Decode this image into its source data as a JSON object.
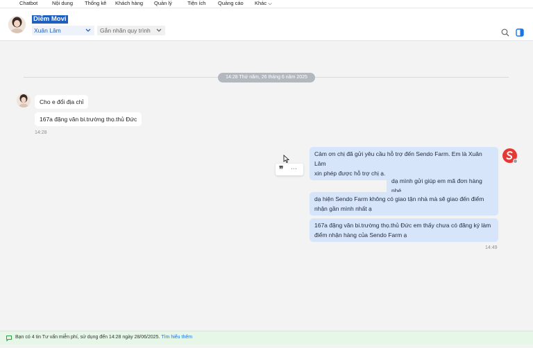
{
  "nav": {
    "items": [
      {
        "label": "Chatbot"
      },
      {
        "label": "Nội dung"
      },
      {
        "label": "Thống kê"
      },
      {
        "label": "Khách hàng"
      },
      {
        "label": "Quản lý"
      },
      {
        "label": "Tiện ích"
      },
      {
        "label": "Quảng cáo"
      },
      {
        "label": "Khác"
      }
    ]
  },
  "header": {
    "customer_name": "Diễm Movi",
    "assignee": "Xuân Lâm",
    "label_placeholder": "Gắn nhãn quy trình",
    "search_icon": "search-icon",
    "panel_icon": "side-panel-icon"
  },
  "chat": {
    "date_separator": "14:28 Thứ năm, 26 tháng 6 năm 2025",
    "incoming": [
      {
        "text": "Cho e đổi địa chỉ"
      },
      {
        "text": "167a đặng văn bi.trường thọ.thủ Đức"
      }
    ],
    "incoming_time": "14:28",
    "outgoing": [
      {
        "lines": [
          "Cảm ơn chị đã gửi yêu cầu hỗ trợ đến Sendo Farm. Em là Xuân Lâm",
          "xin phép được hỗ trợ chị ạ."
        ]
      },
      {
        "lines": [
          "dạ mình gửi giúp em mã đơn hàng nhé."
        ]
      },
      {
        "lines": [
          "dạ hiện Sendo Farm không có giao tận nhà mà sẽ giao đến điểm",
          "nhận gần mình nhất ạ"
        ]
      },
      {
        "lines": [
          "167a đặng văn bi.trường thọ.thủ Đức em thấy chưa có đăng ký làm",
          "điểm nhận hàng của Sendo Farm ạ"
        ]
      }
    ],
    "outgoing_time": "14:49",
    "tools": {
      "quote_glyph": "❞",
      "more_glyph": "···"
    },
    "accent": "#d7e5fb"
  },
  "footer": {
    "notice": "Bạn có 4 tin Tư vấn miễn phí, sử dụng đến 14:28 ngày 28/06/2025.",
    "link": "Tìm hiểu thêm"
  }
}
